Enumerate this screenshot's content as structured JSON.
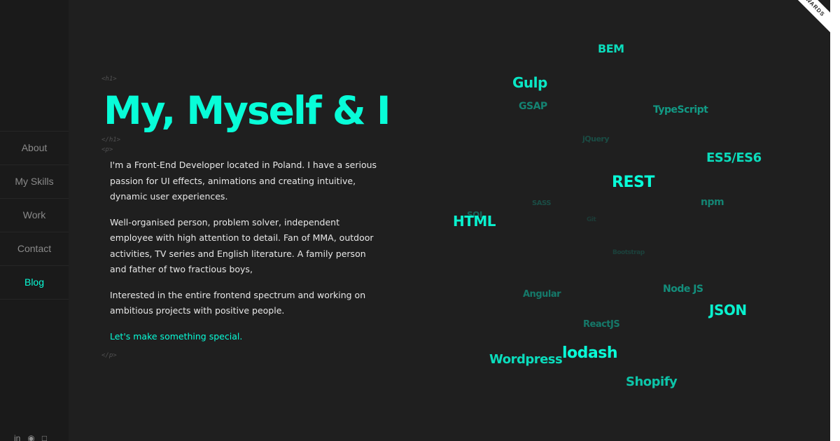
{
  "sidebar": {
    "items": [
      {
        "label": "About"
      },
      {
        "label": "My Skills"
      },
      {
        "label": "Work"
      },
      {
        "label": "Contact"
      },
      {
        "label": "Blog"
      }
    ],
    "active": "Blog",
    "social_icons": [
      "linkedin-icon",
      "github-icon",
      "skype-icon"
    ]
  },
  "code_tags": {
    "h1_open": "<h1>",
    "h1_close": "</h1>",
    "p_open": "<p>",
    "p_close": "</p>"
  },
  "main": {
    "title": "My, Myself & I",
    "paragraphs": [
      "I'm a Front-End Developer located in Poland. I have a serious passion for UI effects, animations and creating intuitive, dynamic user experiences.",
      "Well-organised person, problem solver, independent employee with high attention to detail. Fan of MMA, outdoor activities, TV series and English literature. A family person and father of two fractious boys,",
      "Interested in the entire frontend spectrum and working on ambitious projects with positive people."
    ],
    "cta": "Let's make something special."
  },
  "word_cloud": [
    {
      "text": "BEM",
      "size": 16,
      "opacity": 0.85
    },
    {
      "text": "Gulp",
      "size": 20,
      "opacity": 0.9
    },
    {
      "text": "GSAP",
      "size": 14,
      "opacity": 0.45
    },
    {
      "text": "TypeScript",
      "size": 14,
      "opacity": 0.55
    },
    {
      "text": "jQuery",
      "size": 11,
      "opacity": 0.2
    },
    {
      "text": "ES5/ES6",
      "size": 18,
      "opacity": 0.85
    },
    {
      "text": "REST",
      "size": 22,
      "opacity": 1.0
    },
    {
      "text": "SASS",
      "size": 10,
      "opacity": 0.2
    },
    {
      "text": "npm",
      "size": 14,
      "opacity": 0.45
    },
    {
      "text": "SQL",
      "size": 12,
      "opacity": 0.3
    },
    {
      "text": "HTML",
      "size": 20,
      "opacity": 0.95
    },
    {
      "text": "Git",
      "size": 9,
      "opacity": 0.12
    },
    {
      "text": "Bootstrap",
      "size": 9,
      "opacity": 0.15
    },
    {
      "text": "Angular",
      "size": 13,
      "opacity": 0.4
    },
    {
      "text": "Node JS",
      "size": 14,
      "opacity": 0.5
    },
    {
      "text": "JSON",
      "size": 20,
      "opacity": 0.95
    },
    {
      "text": "ReactJS",
      "size": 13,
      "opacity": 0.4
    },
    {
      "text": "lodash",
      "size": 22,
      "opacity": 1.0
    },
    {
      "text": "Wordpress",
      "size": 18,
      "opacity": 0.85
    },
    {
      "text": "Shopify",
      "size": 18,
      "opacity": 0.75
    }
  ],
  "ribbon": {
    "text": "AWWWARDS"
  },
  "colors": {
    "accent": "#08fdd8",
    "background": "#1f1f1f",
    "sidebar": "#1a1a1a",
    "text": "#e8e8e8",
    "nav_text": "#8a8a8a"
  }
}
